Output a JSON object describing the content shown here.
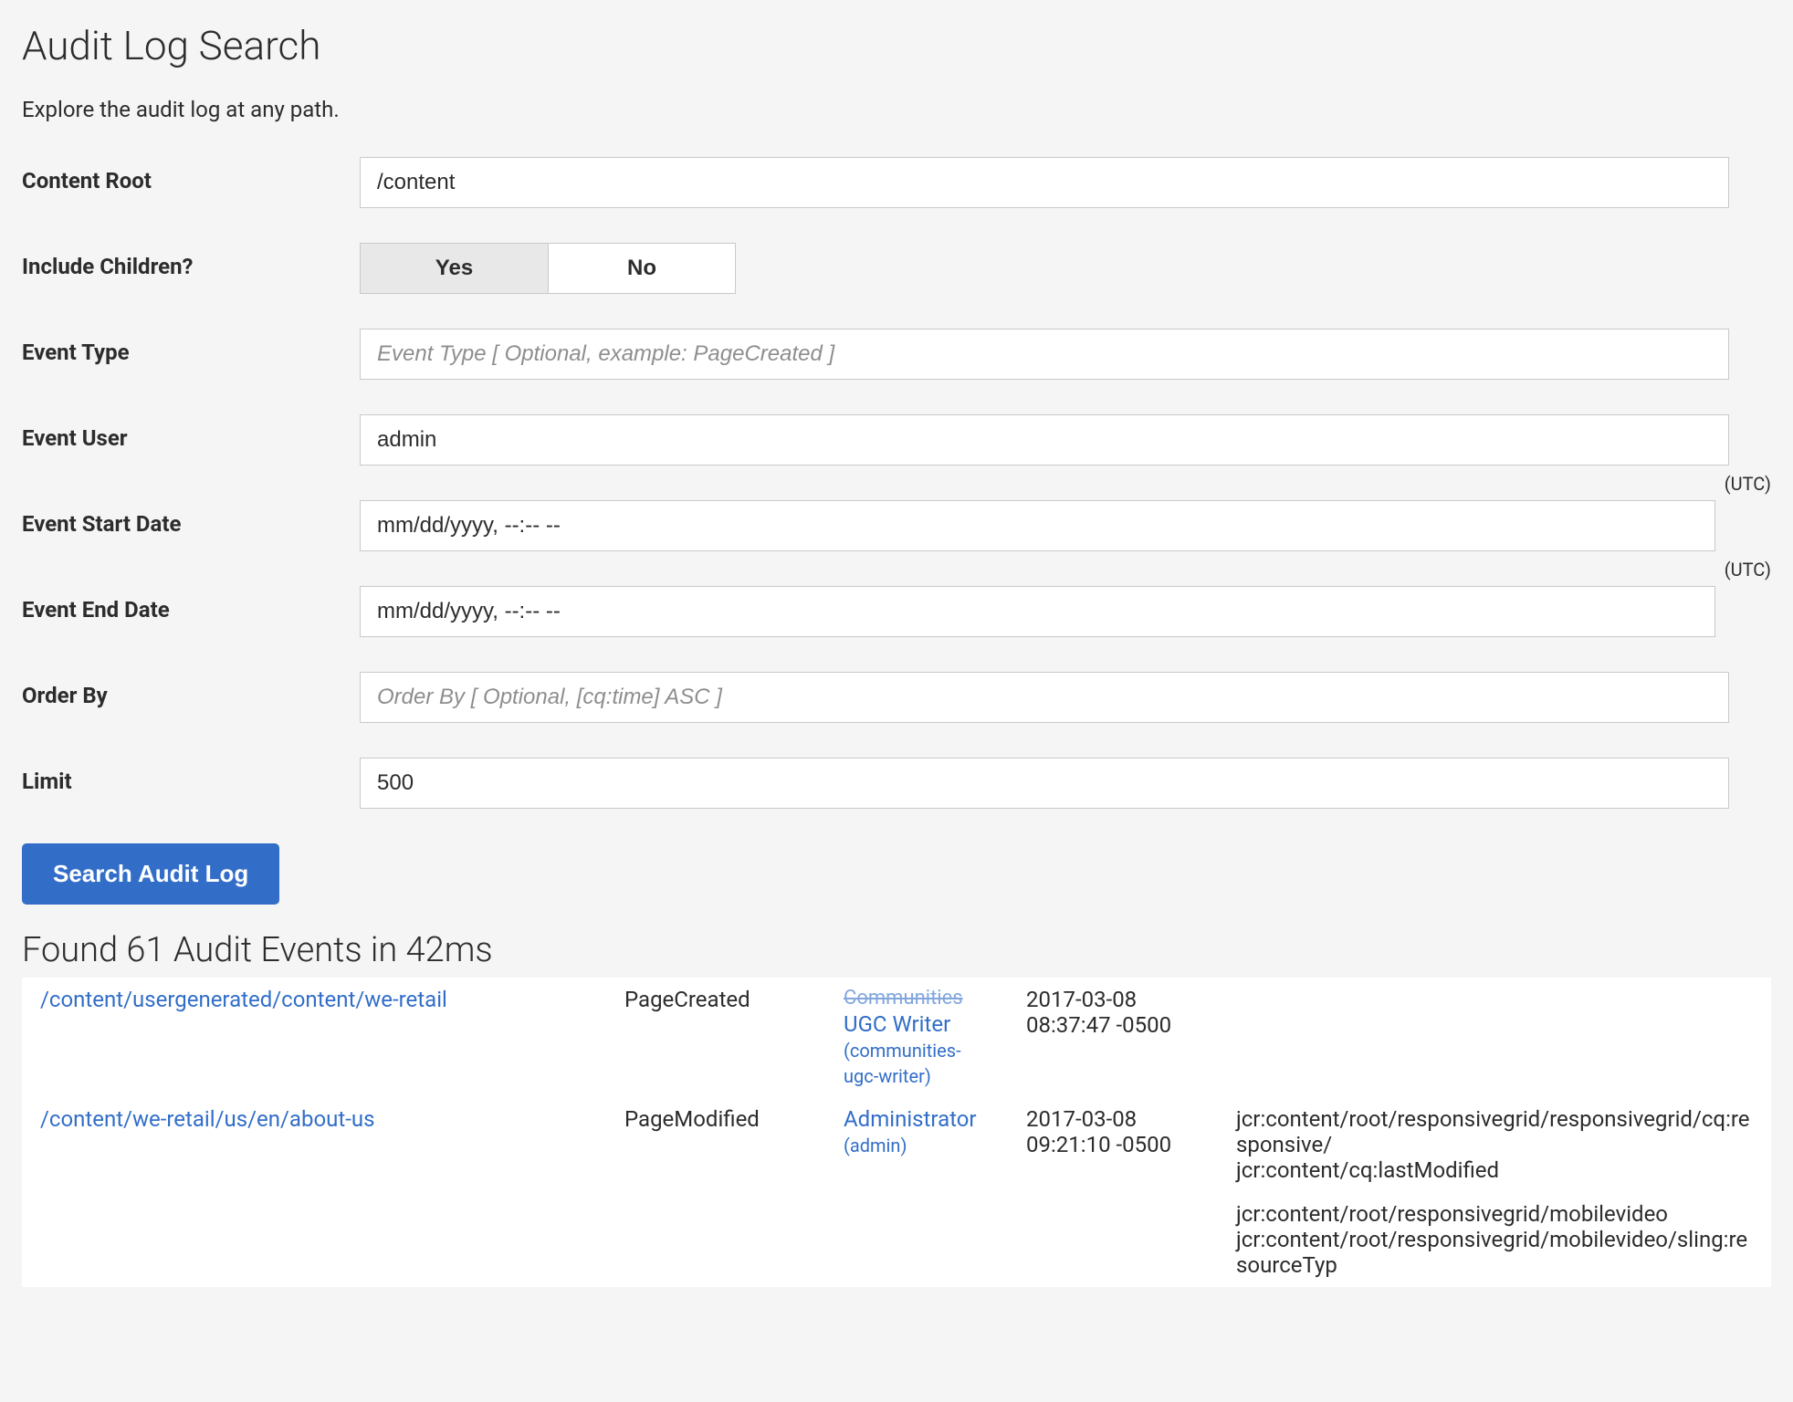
{
  "header": {
    "title": "Audit Log Search",
    "description": "Explore the audit log at any path."
  },
  "form": {
    "content_root": {
      "label": "Content Root",
      "value": "/content"
    },
    "include_children": {
      "label": "Include Children?",
      "yes": "Yes",
      "no": "No",
      "selected": "yes"
    },
    "event_type": {
      "label": "Event Type",
      "placeholder": "Event Type [ Optional, example: PageCreated ]",
      "value": ""
    },
    "event_user": {
      "label": "Event User",
      "value": "admin"
    },
    "start_date": {
      "label": "Event Start Date",
      "value": "mm/dd/yyyy, --:-- --",
      "note": "(UTC)"
    },
    "end_date": {
      "label": "Event End Date",
      "value": "mm/dd/yyyy, --:-- --",
      "note": "(UTC)"
    },
    "order_by": {
      "label": "Order By",
      "placeholder": "Order By [ Optional, [cq:time] ASC ]",
      "value": ""
    },
    "limit": {
      "label": "Limit",
      "value": "500"
    },
    "submit_label": "Search Audit Log"
  },
  "results": {
    "heading": "Found 61 Audit Events in 42ms",
    "rows": [
      {
        "path": "/content/usergenerated/content/we-retail",
        "event_type": "PageCreated",
        "user_cut": "Communities",
        "user_display": "UGC Writer",
        "user_sub": "(communities-ugc-writer)",
        "time": "2017-03-08 08:37:47 -0500",
        "props": []
      },
      {
        "path": "/content/we-retail/us/en/about-us",
        "event_type": "PageModified",
        "user_cut": "",
        "user_display": "Administrator",
        "user_sub": "(admin)",
        "time": "2017-03-08 09:21:10 -0500",
        "props": [
          "jcr:content/root/responsivegrid/responsivegrid/cq:responsive/",
          "jcr:content/cq:lastModified"
        ]
      },
      {
        "path": "",
        "event_type": "",
        "user_cut": "",
        "user_display": "",
        "user_sub": "",
        "time": "",
        "props": [
          "jcr:content/root/responsivegrid/mobilevideo",
          "jcr:content/root/responsivegrid/mobilevideo/sling:resourceTyp"
        ]
      }
    ]
  }
}
